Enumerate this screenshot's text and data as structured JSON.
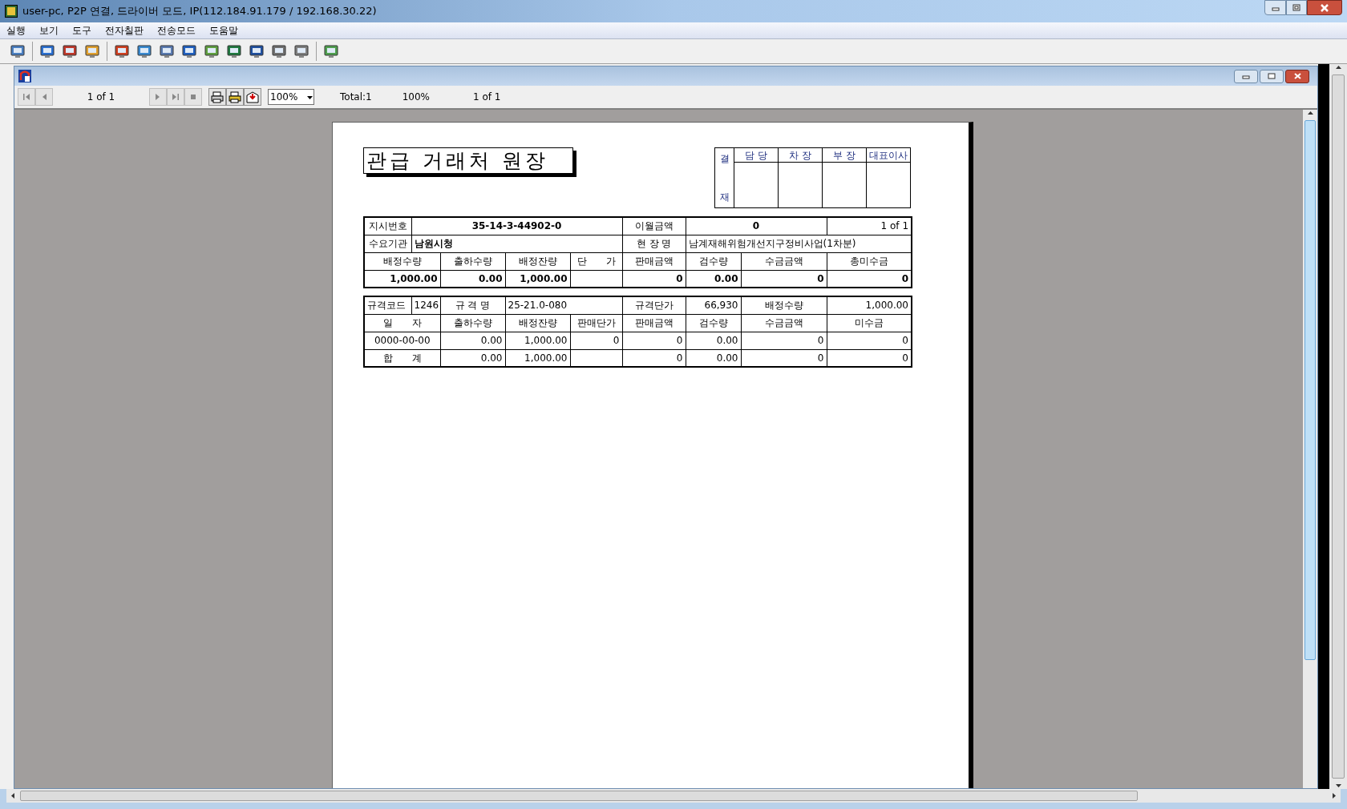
{
  "window": {
    "title": "user-pc, P2P 연결, 드라이버 모드, IP(112.184.91.179 / 192.168.30.22)"
  },
  "menu": [
    "실행",
    "보기",
    "도구",
    "전자칠판",
    "전송모드",
    "도움말"
  ],
  "report_toolbar": {
    "page": "1 of 1",
    "zoom": "100%",
    "total": "Total:1",
    "zoom_reading": "100%",
    "page_reading": "1 of 1"
  },
  "report": {
    "title": "관급 거래처 원장",
    "approval": {
      "label": [
        "결",
        "재"
      ],
      "columns": [
        "담 당",
        "차 장",
        "부 장",
        "대표이사"
      ]
    },
    "summary": [
      [
        "지시번호",
        "35-14-3-44902-0",
        "이월금액",
        "0",
        "1 of 1"
      ],
      [
        "수요기관",
        "남원시청",
        "현 장 명",
        "남계재해위험개선지구정비사업(1차분)"
      ],
      [
        "배정수량",
        "출하수량",
        "배정잔량",
        "단　　가",
        "판매금액",
        "검수량",
        "수금금액",
        "총미수금"
      ],
      [
        "1,000.00",
        "0.00",
        "1,000.00",
        "0",
        "0.00",
        "0",
        "0"
      ]
    ],
    "detail": [
      [
        "규격코드",
        "1246",
        "규 격 명",
        "25-21.0-080",
        "규격단가",
        "66,930",
        "배정수량",
        "1,000.00"
      ],
      [
        "일　　자",
        "출하수량",
        "배정잔량",
        "판매단가",
        "판매금액",
        "검수량",
        "수금금액",
        "미수금"
      ],
      [
        "0000-00-00",
        "0.00",
        "1,000.00",
        "0",
        "0",
        "0.00",
        "0",
        "0"
      ],
      [
        "합　　계",
        "0.00",
        "1,000.00",
        "0",
        "0.00",
        "0",
        "0"
      ]
    ]
  }
}
